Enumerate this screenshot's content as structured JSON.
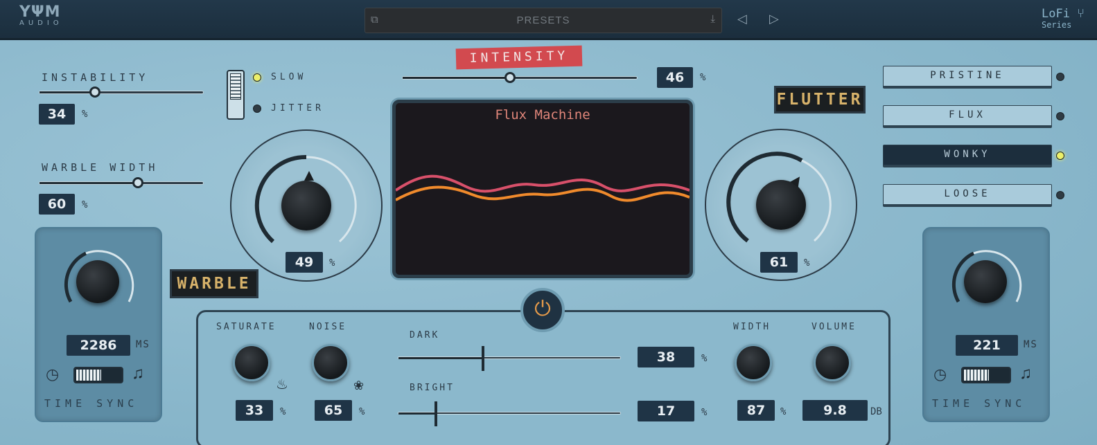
{
  "header": {
    "brand": "YΨM",
    "brand_sub": "AUDIO",
    "presets_label": "PRESETS",
    "series_title": "LoFi",
    "series_sub": "Series"
  },
  "intensity": {
    "label": "INTENSITY",
    "value": "46",
    "unit": "%",
    "level": 0.46
  },
  "instability": {
    "label": "INSTABILITY",
    "value": "34",
    "unit": "%",
    "level": 0.34
  },
  "warble_width": {
    "label": "WARBLE WIDTH",
    "value": "60",
    "unit": "%",
    "level": 0.6
  },
  "mode_switch": {
    "slow": "SLOW",
    "jitter": "JITTER",
    "selected": "slow"
  },
  "warble": {
    "label": "WARBLE",
    "value": "49",
    "unit": "%"
  },
  "flutter": {
    "label": "FLUTTER",
    "value": "61",
    "unit": "%"
  },
  "screen": {
    "title": "Flux Machine"
  },
  "modes": [
    {
      "label": "PRISTINE",
      "active": false
    },
    {
      "label": "FLUX",
      "active": false
    },
    {
      "label": "WONKY",
      "active": true
    },
    {
      "label": "LOOSE",
      "active": false
    }
  ],
  "left_time": {
    "value": "2286",
    "unit": "MS",
    "footer": "TIME SYNC"
  },
  "right_time": {
    "value": "221",
    "unit": "MS",
    "footer": "TIME SYNC"
  },
  "saturate": {
    "label": "SATURATE",
    "value": "33",
    "unit": "%"
  },
  "noise": {
    "label": "NOISE",
    "value": "65",
    "unit": "%"
  },
  "dark": {
    "label": "DARK",
    "value": "38",
    "unit": "%",
    "level": 0.38
  },
  "bright": {
    "label": "BRIGHT",
    "value": "17",
    "unit": "%",
    "level": 0.17
  },
  "width": {
    "label": "WIDTH",
    "value": "87",
    "unit": "%"
  },
  "volume": {
    "label": "VOLUME",
    "value": "9.8",
    "unit": "DB"
  },
  "colors": {
    "accent_red": "#d24a4f",
    "nixie": "#d7b26a",
    "led_on": "#ecf06a",
    "power": "#e49a4a"
  }
}
